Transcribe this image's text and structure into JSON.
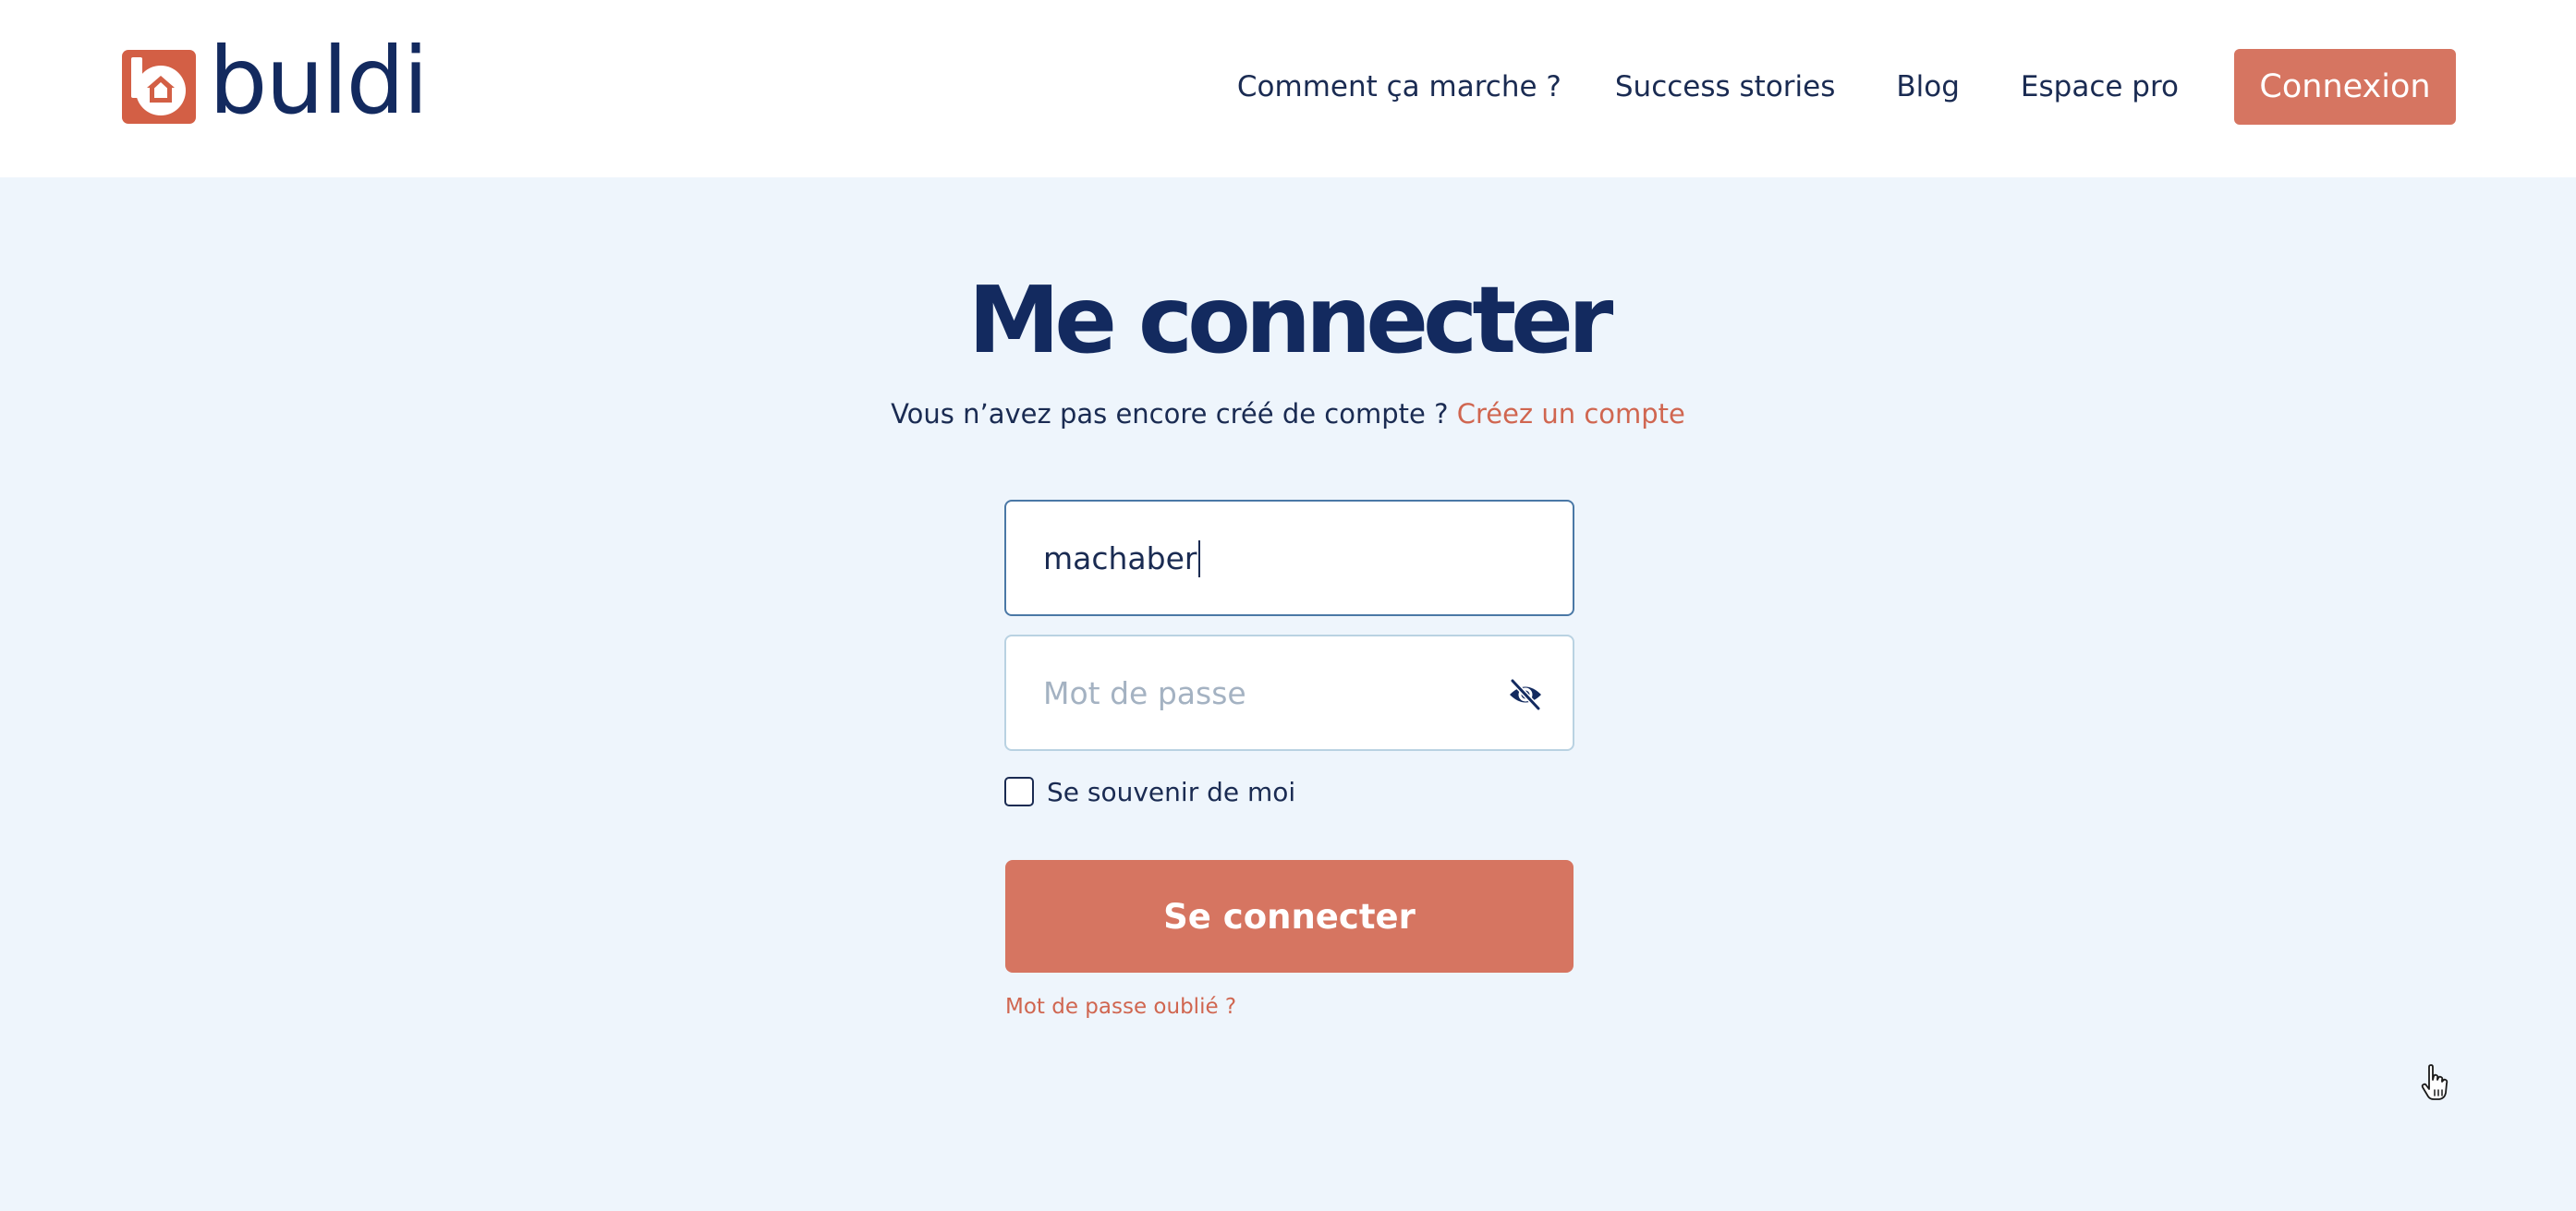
{
  "header": {
    "logo_text": "buldi",
    "nav": [
      {
        "label": "Comment ça marche ?"
      },
      {
        "label": "Success stories"
      },
      {
        "label": "Blog"
      },
      {
        "label": "Espace pro"
      }
    ],
    "login_button": "Connexion"
  },
  "main": {
    "title": "Me connecter",
    "subtitle_text": "Vous n’avez pas encore créé de compte ?",
    "create_account_link": "Créez un compte",
    "username": {
      "value": "machaber"
    },
    "password": {
      "value": "",
      "placeholder": "Mot de passe",
      "toggle_icon": "eye-slash-icon"
    },
    "remember_me": {
      "label": "Se souvenir de moi",
      "checked": false
    },
    "submit_label": "Se connecter",
    "forgot_password": "Mot de passe oublié ?"
  },
  "colors": {
    "brand": "#d67561",
    "navy": "#132a5f",
    "background": "#eef5fc",
    "link": "#d06650"
  }
}
